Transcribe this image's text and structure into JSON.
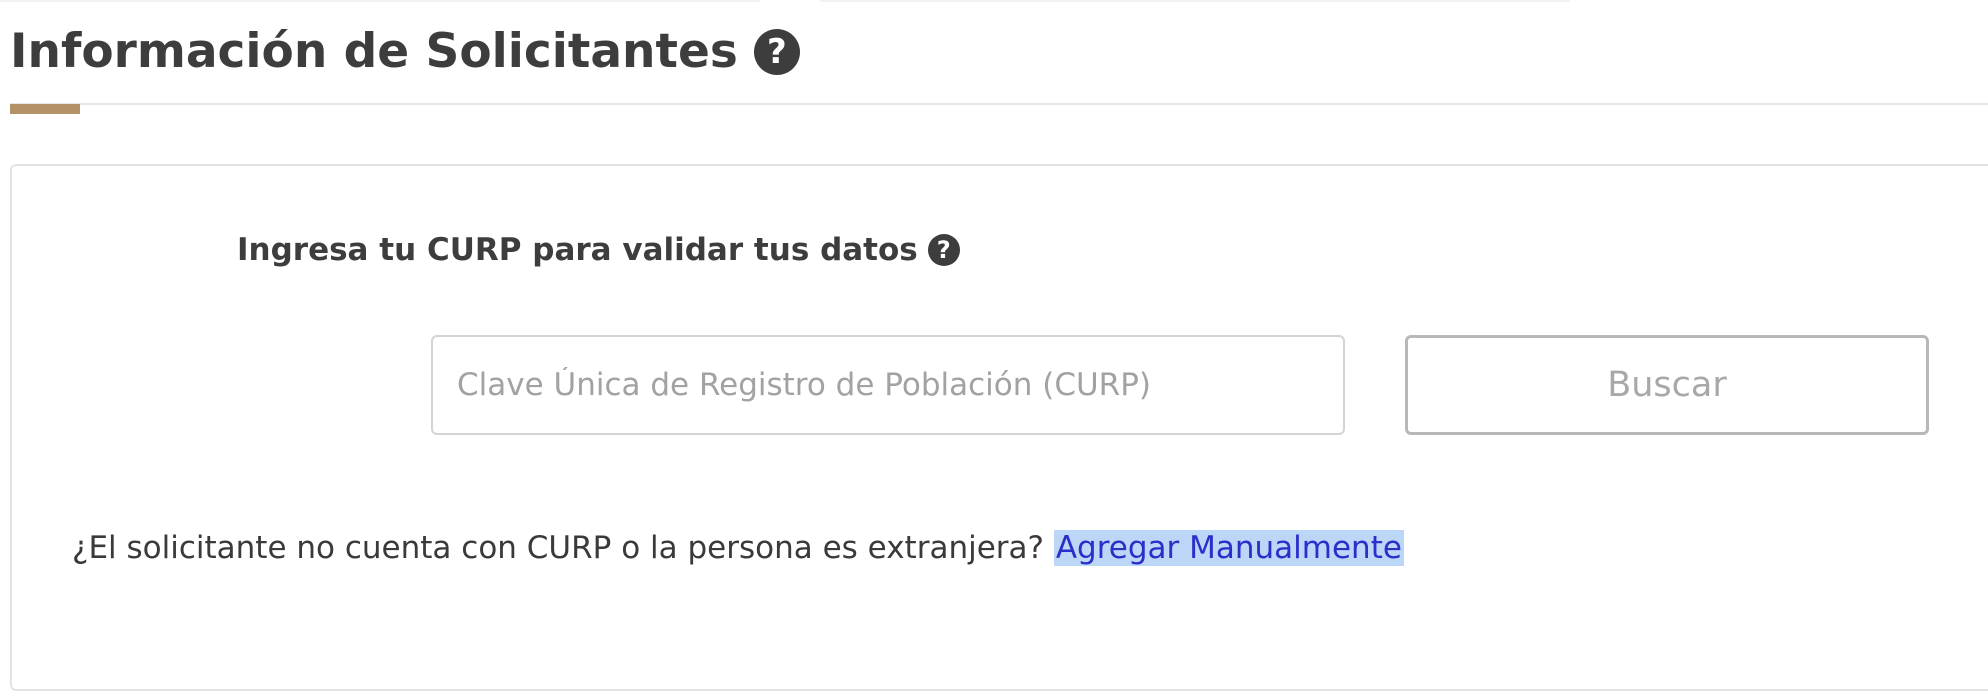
{
  "header": {
    "title": "Información de Solicitantes",
    "help_glyph": "?",
    "accent_color": "#b39366"
  },
  "curp_section": {
    "prompt": "Ingresa tu CURP para validar tus datos",
    "help_glyph": "?",
    "input": {
      "value": "",
      "placeholder": "Clave Única de Registro de Población (CURP)"
    },
    "search_button_label": "Buscar"
  },
  "manual_entry": {
    "question": "¿El solicitante no cuenta con CURP o la persona es extranjera?",
    "link_label": "Agregar Manualmente",
    "link_color": "#2b2ec9",
    "selection_highlight_color": "#bcd6f8"
  },
  "icons": {
    "title_help": "question-circle-icon",
    "prompt_help": "question-circle-icon"
  }
}
